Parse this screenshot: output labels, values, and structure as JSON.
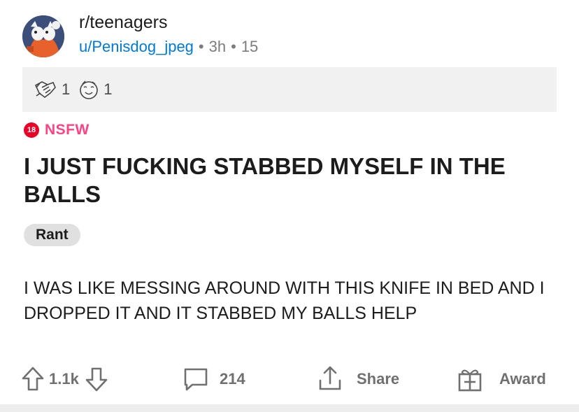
{
  "post": {
    "subreddit": "r/teenagers",
    "author": "u/Penisdog_jpeg",
    "time": "3h",
    "score_small": "15",
    "awards": [
      {
        "icon": "handshake-award-icon",
        "count": "1"
      },
      {
        "icon": "wholesome-face-award-icon",
        "count": "1"
      }
    ],
    "nsfw_badge": "18",
    "nsfw_label": "NSFW",
    "title": "I JUST FUCKING STABBED MYSELF IN THE BALLS",
    "flair": "Rant",
    "body": "I WAS LIKE MESSING AROUND WITH THIS KNIFE IN BED AND I DROPPED IT AND IT STABBED MY BALLS HELP"
  },
  "actions": {
    "votes": "1.1k",
    "comments": "214",
    "share_label": "Share",
    "award_label": "Award"
  },
  "colors": {
    "link": "#0079d3",
    "nsfw": "#ff4581",
    "gray_text": "#707070"
  }
}
